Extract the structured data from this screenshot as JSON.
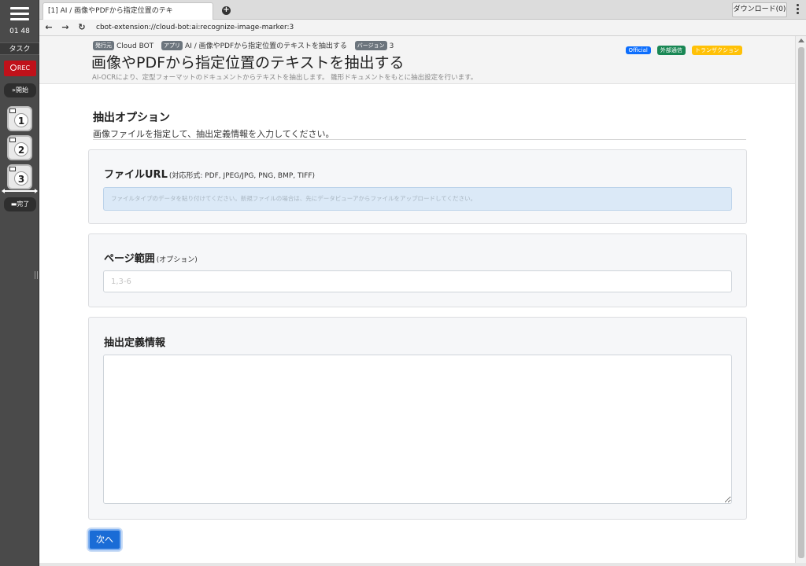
{
  "sidebar": {
    "timer": "01 48",
    "task_label": "タスク",
    "rec_label": "REC",
    "start_label": "開始",
    "steps": [
      "1",
      "2",
      "3"
    ],
    "done_label": "完了"
  },
  "browser": {
    "tab_title": "[1] AI / 画像やPDFから指定位置のテキ",
    "download_label": "ダウンロード(0)",
    "url": "cbot-extension://cloud-bot:ai:recognize-image-marker:3"
  },
  "header": {
    "publisher_tag": "発行元",
    "publisher": "Cloud BOT",
    "app_tag": "アプリ",
    "app": "AI / 画像やPDFから指定位置のテキストを抽出する",
    "version_tag": "バージョン",
    "version": "3",
    "badges": {
      "official": "Official",
      "external": "外部通信",
      "transaction": "トランザクション"
    },
    "title": "画像やPDFから指定位置のテキストを抽出する",
    "subtitle": "AI-OCRにより、定型フォーマットのドキュメントからテキストを抽出します。 雛形ドキュメントをもとに抽出設定を行います。"
  },
  "section": {
    "title": "抽出オプション",
    "description": "画像ファイルを指定して、抽出定義情報を入力してください。"
  },
  "form": {
    "file_url": {
      "label": "ファイルURL",
      "hint": "(対応形式: PDF, JPEG/JPG, PNG, BMP, TIFF)",
      "placeholder": "ファイルタイプのデータを貼り付けてください。新規ファイルの場合は、先にデータビューアからファイルをアップロードしてください。"
    },
    "page_range": {
      "label": "ページ範囲",
      "hint": "(オプション)",
      "placeholder": "1,3-6"
    },
    "definition": {
      "label": "抽出定義情報",
      "value": ""
    },
    "next_label": "次へ"
  },
  "colors": {
    "sidebar_bg": "#4a4a4a",
    "rec_red": "#c0111a",
    "primary_blue": "#1a6cd6",
    "badge_official": "#0d6efd",
    "badge_external": "#198754",
    "badge_transaction": "#ffc107"
  }
}
